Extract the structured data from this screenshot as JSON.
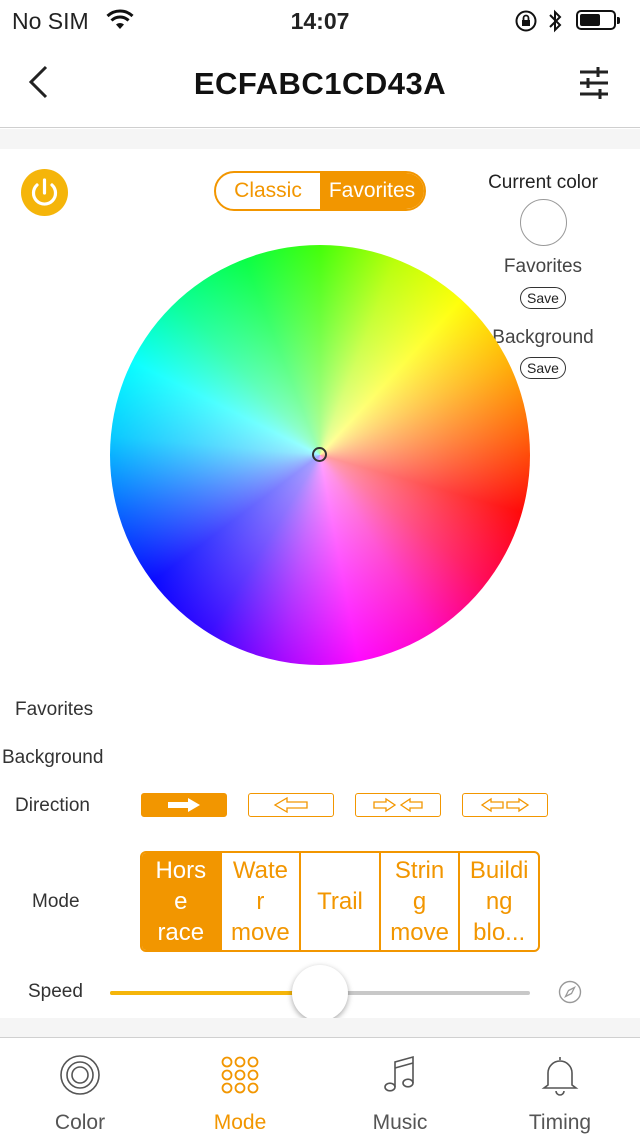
{
  "status_bar": {
    "carrier": "No SIM",
    "time": "14:07"
  },
  "header": {
    "title": "ECFABC1CD43A"
  },
  "color_tabs": [
    {
      "label": "Classic",
      "active": false
    },
    {
      "label": "Favorites",
      "active": true
    }
  ],
  "side_panel": {
    "current_color_label": "Current color",
    "current_color": "#ffffff",
    "favorites_label": "Favorites",
    "favorites_save": "Save",
    "background_label": "Background",
    "background_save": "Save"
  },
  "labels": {
    "favorites": "Favorites",
    "background": "Background",
    "direction": "Direction",
    "mode": "Mode",
    "speed": "Speed"
  },
  "direction": {
    "options": [
      "right-arrow-icon",
      "left-arrow-icon",
      "converge-arrows-icon",
      "diverge-arrows-icon"
    ],
    "selected_index": 0
  },
  "modes": [
    {
      "label": "Hors\ne\nrace",
      "active": true
    },
    {
      "label": "Wate\nr\nmove",
      "active": false
    },
    {
      "label": "Trail",
      "active": false
    },
    {
      "label": "Strin\ng\nmove",
      "active": false
    },
    {
      "label": "Buildi\nng\nblo...",
      "active": false
    }
  ],
  "speed": {
    "value": 0.5
  },
  "tabs": [
    {
      "label": "Color",
      "icon": "color-rings-icon",
      "active": false
    },
    {
      "label": "Mode",
      "icon": "mode-dots-icon",
      "active": true
    },
    {
      "label": "Music",
      "icon": "music-note-icon",
      "active": false
    },
    {
      "label": "Timing",
      "icon": "bell-icon",
      "active": false
    }
  ],
  "colors": {
    "accent": "#f29600",
    "power": "#f5b50a",
    "slider_fill": "#f5b50a"
  }
}
